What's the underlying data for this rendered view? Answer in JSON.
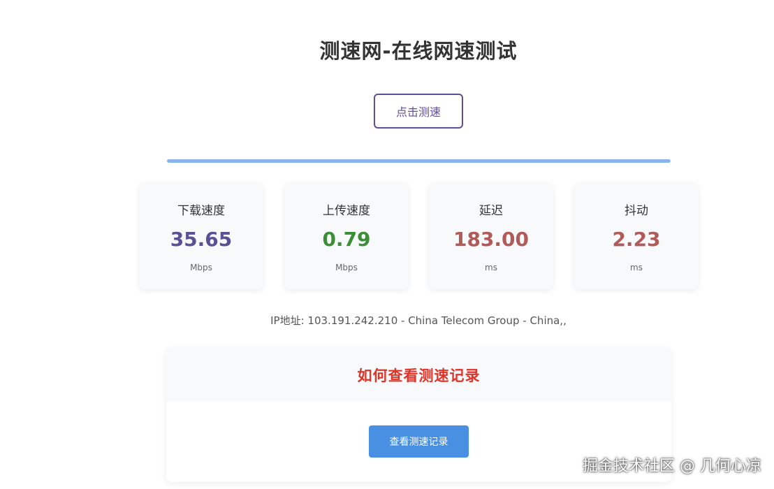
{
  "header": {
    "title": "测速网-在线网速测试"
  },
  "controls": {
    "start_label": "点击测速",
    "progress_percent": 100
  },
  "metrics": [
    {
      "label": "下载速度",
      "value": "35.65",
      "unit": "Mbps",
      "color": "#5b4f98"
    },
    {
      "label": "上传速度",
      "value": "0.79",
      "unit": "Mbps",
      "color": "#3a8f35"
    },
    {
      "label": "延迟",
      "value": "183.00",
      "unit": "ms",
      "color": "#b05a5a"
    },
    {
      "label": "抖动",
      "value": "2.23",
      "unit": "ms",
      "color": "#b05a5a"
    }
  ],
  "ip_info": {
    "text": "IP地址: 103.191.242.210 - China Telecom Group - China,,"
  },
  "records": {
    "title": "如何查看测速记录",
    "button_label": "查看测速记录"
  },
  "watermark": {
    "text": "掘金技术社区 @ 几何心凉"
  },
  "colors": {
    "accent": "#5b4f98",
    "progress": "#8ab4ef",
    "record_title": "#e03428",
    "record_button": "#4a90e2"
  }
}
